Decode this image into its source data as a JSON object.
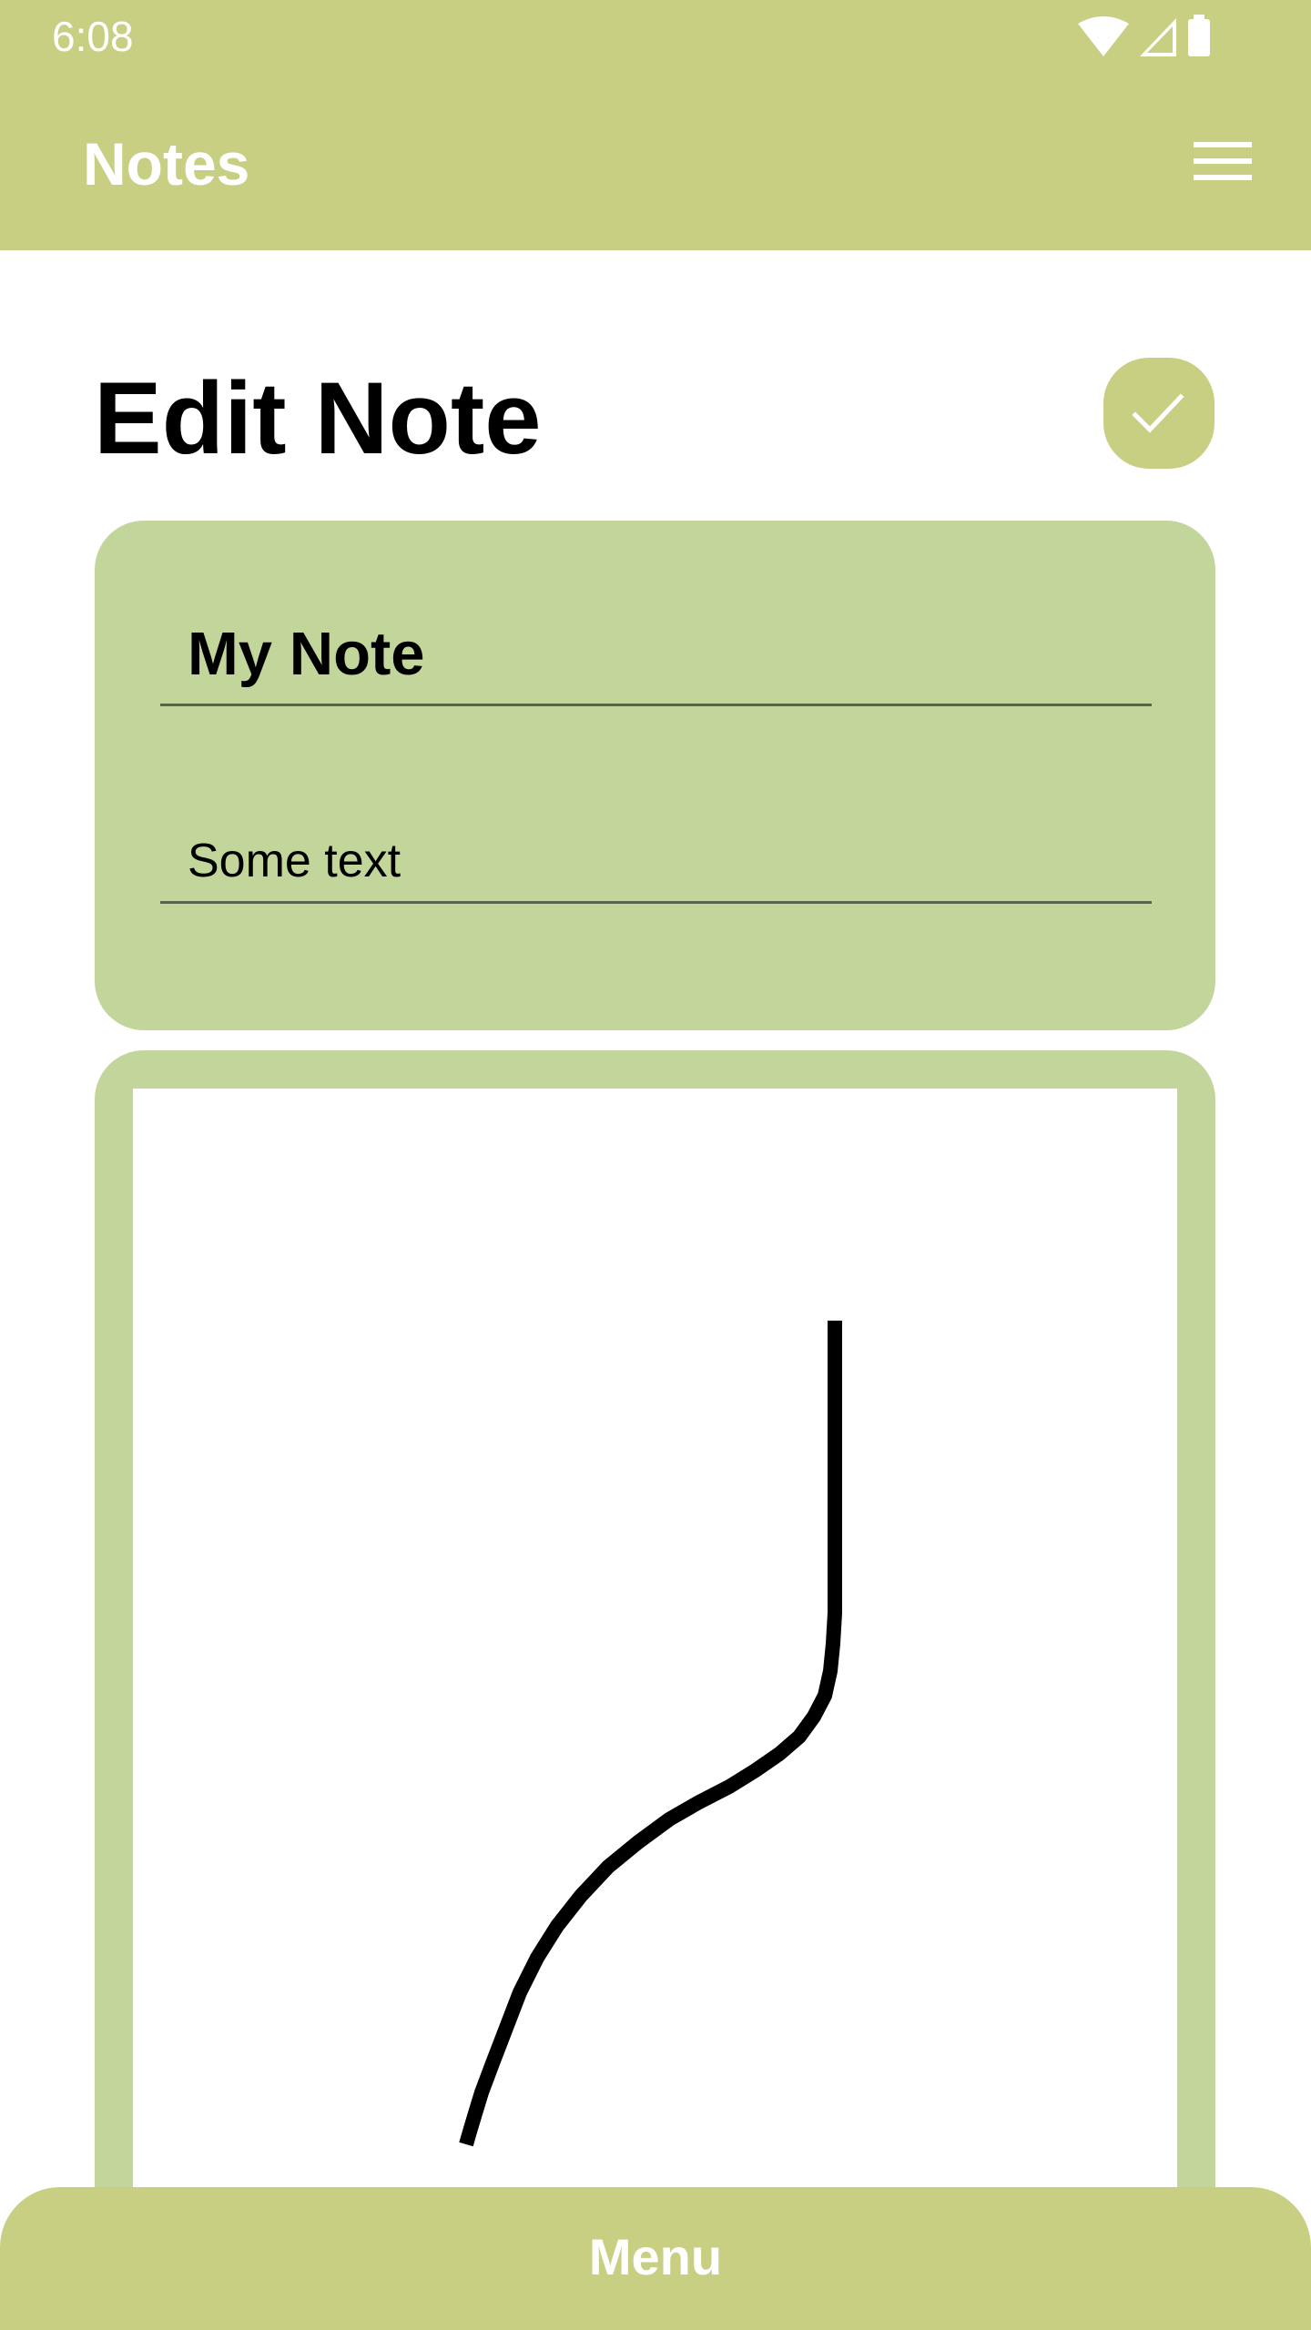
{
  "status_bar": {
    "time": "6:08",
    "icons": [
      "wifi-icon",
      "cellular-signal-icon",
      "battery-icon"
    ]
  },
  "app_bar": {
    "title": "Notes",
    "menu_icon": "hamburger-menu-icon"
  },
  "page": {
    "title": "Edit Note",
    "save_icon": "checkmark-icon"
  },
  "form": {
    "title_value": "My Note",
    "body_value": "Some text"
  },
  "bottom_bar": {
    "label": "Menu"
  },
  "colors": {
    "app_bar": "#c8cf83",
    "card": "#c2d69c",
    "stroke": "#000000"
  }
}
